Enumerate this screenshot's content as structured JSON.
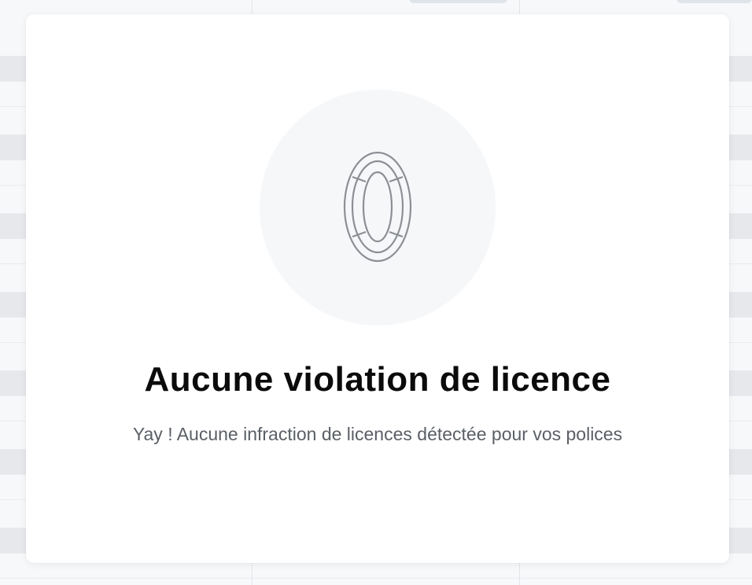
{
  "modal": {
    "icon": "zero-outline-icon",
    "title": "Aucune violation de licence",
    "subtitle": "Yay ! Aucune infraction de licences détectée pour vos polices"
  },
  "colors": {
    "title": "#0b0b0c",
    "subtitle": "#5a5f66",
    "circle_bg": "#f6f7f9",
    "icon_stroke": "#8c8f94"
  }
}
